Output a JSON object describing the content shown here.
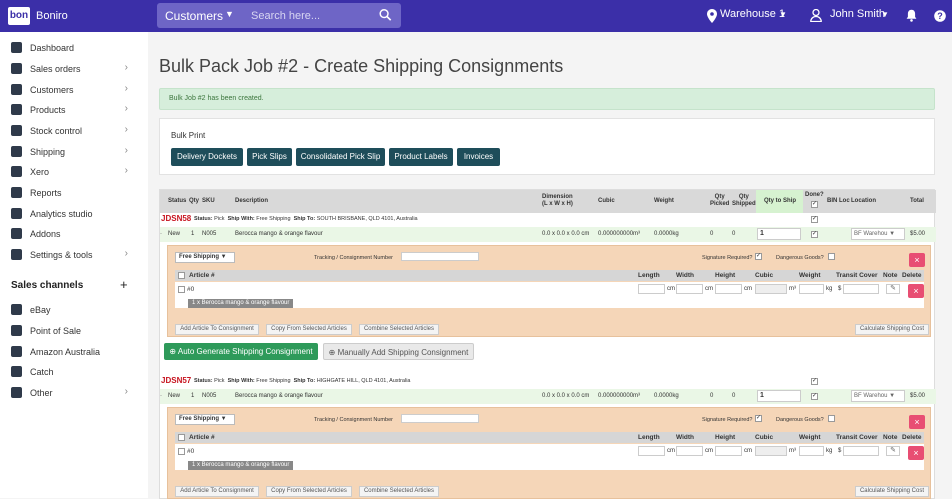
{
  "topbar": {
    "logo": "bon",
    "brand": "Boniro",
    "search_select": "Customers",
    "search_placeholder": "Search here...",
    "warehouse": "Warehouse 1",
    "user": "John Smith"
  },
  "sidebar": {
    "items": [
      {
        "label": "Dashboard",
        "icon": "home-icon",
        "chevron": false
      },
      {
        "label": "Sales orders",
        "icon": "document-icon",
        "chevron": true
      },
      {
        "label": "Customers",
        "icon": "people-icon",
        "chevron": true
      },
      {
        "label": "Products",
        "icon": "box-icon",
        "chevron": true
      },
      {
        "label": "Stock control",
        "icon": "checkbox-icon",
        "chevron": true
      },
      {
        "label": "Shipping",
        "icon": "truck-icon",
        "chevron": true
      },
      {
        "label": "Xero",
        "icon": "bank-icon",
        "chevron": true
      },
      {
        "label": "Reports",
        "icon": "chart-icon",
        "chevron": false
      },
      {
        "label": "Analytics studio",
        "icon": "analytics-icon",
        "chevron": false
      },
      {
        "label": "Addons",
        "icon": "plus-square-icon",
        "chevron": false
      },
      {
        "label": "Settings & tools",
        "icon": "gear-icon",
        "chevron": true
      }
    ],
    "sales_channels_heading": "Sales channels",
    "channels": [
      {
        "label": "eBay",
        "icon": "gavel-icon",
        "chevron": false
      },
      {
        "label": "Point of Sale",
        "icon": "store-icon",
        "chevron": false
      },
      {
        "label": "Amazon Australia",
        "icon": "amazon-icon",
        "chevron": false
      },
      {
        "label": "Catch",
        "icon": "catch-icon",
        "chevron": false
      },
      {
        "label": "Other",
        "icon": "sitemap-icon",
        "chevron": true
      }
    ]
  },
  "page": {
    "title": "Bulk Pack Job #2 - Create Shipping Consignments",
    "alert": "Bulk Job #2 has been created."
  },
  "bulk_print": {
    "title": "Bulk Print",
    "buttons": [
      "Delivery Dockets",
      "Pick Slips",
      "Consolidated Pick Slip",
      "Product Labels",
      "Invoices"
    ]
  },
  "table": {
    "headers": {
      "status": "Status",
      "qty": "Qty",
      "sku": "SKU",
      "description": "Description",
      "dimension": "Dimension\n(L x W x H)",
      "cubic": "Cubic",
      "weight": "Weight",
      "qty_picked": "Qty\nPicked",
      "qty_shipped": "Qty\nShipped",
      "qty_to_ship": "Qty to Ship",
      "done": "Done?",
      "bin_loc": "BIN Loc",
      "location": "Location",
      "total": "Total"
    },
    "orders": [
      {
        "id": "JDSN58",
        "status_label": "Status:",
        "status": "Pick",
        "ship_with_label": "Ship With:",
        "ship_with": "Free Shipping",
        "ship_to_label": "Ship To:",
        "ship_to": "SOUTH BRISBANE, QLD 4101, Australia",
        "item": {
          "status": "New",
          "qty": "1",
          "sku": "N005",
          "description": "Berocca mango & orange flavour",
          "dimension": "0.0 x 0.0 x 0.0 cm",
          "cubic": "0.000000000m³",
          "weight": "0.0000kg",
          "qty_picked": "0",
          "qty_shipped": "0",
          "qty_to_ship": "1",
          "location": "BF Warehou ▼",
          "total": "$5.00"
        }
      },
      {
        "id": "JDSN57",
        "status_label": "Status:",
        "status": "Pick",
        "ship_with_label": "Ship With:",
        "ship_with": "Free Shipping",
        "ship_to_label": "Ship To:",
        "ship_to": "HIGHGATE HILL, QLD 4101, Australia",
        "item": {
          "status": "New",
          "qty": "1",
          "sku": "N005",
          "description": "Berocca mango & orange flavour",
          "dimension": "0.0 x 0.0 x 0.0 cm",
          "cubic": "0.000000000m³",
          "weight": "0.0000kg",
          "qty_picked": "0",
          "qty_shipped": "0",
          "qty_to_ship": "1",
          "location": "BF Warehou ▼",
          "total": "$5.00"
        }
      }
    ]
  },
  "consignment": {
    "shipping_select": "Free Shipping ▼",
    "tracking_label": "Tracking / Consignment Number",
    "signature_label": "Signature Required?",
    "dangerous_label": "Dangerous Goods?",
    "article_headers": {
      "article": "Article #",
      "length": "Length",
      "width": "Width",
      "height": "Height",
      "cubic": "Cubic",
      "weight": "Weight",
      "transit_cover": "Transit Cover",
      "note": "Note",
      "delete": "Delete"
    },
    "article_number": "#0",
    "article_tag": "1 x Berocca mango & orange flavour",
    "unit_cm": "cm",
    "unit_m3": "m³",
    "unit_kg": "kg",
    "currency": "$",
    "buttons": {
      "add_article": "Add Article To Consignment",
      "copy_articles": "Copy From Selected Articles",
      "combine_articles": "Combine Selected Articles",
      "calculate": "Calculate Shipping Cost"
    },
    "auto_generate": "Auto Generate Shipping Consignment",
    "manual_add": "Manually Add Shipping Consignment"
  },
  "colors": {
    "topbar": "#3b2fa8",
    "primary_button": "#1e4d5a",
    "order_id": "#c7131f",
    "success": "#2e9a5a",
    "delete": "#e84e73",
    "consignment_bg": "#f5d6b8"
  }
}
